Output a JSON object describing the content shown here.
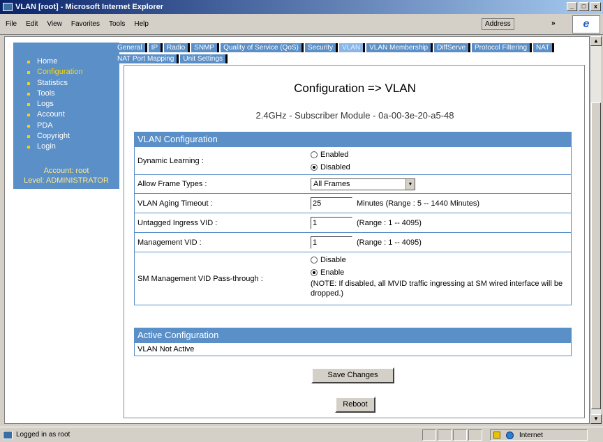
{
  "window": {
    "title": "VLAN [root] - Microsoft Internet Explorer",
    "buttons": [
      "_",
      "□",
      "x"
    ]
  },
  "menubar": {
    "items": [
      "File",
      "Edit",
      "View",
      "Favorites",
      "Tools",
      "Help"
    ],
    "address_label": "Address",
    "go_label": "»"
  },
  "leftnav": {
    "items": [
      "Home",
      "Configuration",
      "Statistics",
      "Tools",
      "Logs",
      "Account",
      "PDA",
      "Copyright",
      "Login"
    ],
    "account_line": "Account: root",
    "level_line": "Level: ADMINISTRATOR"
  },
  "tabs": [
    "General",
    "IP",
    "Radio",
    "SNMP",
    "Quality of Service (QoS)",
    "Security",
    "VLAN",
    "VLAN Membership",
    "DiffServe",
    "Protocol Filtering",
    "NAT",
    "NAT Port Mapping",
    "Unit Settings"
  ],
  "page": {
    "title": "Configuration => VLAN",
    "subtitle": "2.4GHz - Subscriber Module - 0a-00-3e-20-a5-48"
  },
  "vlan_config": {
    "header": "VLAN Configuration",
    "dynamic_learning": {
      "label": "Dynamic Learning :",
      "opt_enabled": "Enabled",
      "opt_disabled": "Disabled",
      "selected": "Disabled"
    },
    "frame_types": {
      "label": "Allow Frame Types :",
      "value": "All Frames"
    },
    "aging_timeout": {
      "label": "VLAN Aging Timeout :",
      "value": "25",
      "hint": "Minutes (Range : 5 -- 1440 Minutes)"
    },
    "untagged_vid": {
      "label": "Untagged Ingress VID :",
      "value": "1",
      "hint": "(Range : 1 -- 4095)"
    },
    "mgmt_vid": {
      "label": "Management VID :",
      "value": "1",
      "hint": "(Range : 1 -- 4095)"
    },
    "passthrough": {
      "label": "SM Management VID Pass-through :",
      "opt_disable": "Disable",
      "opt_enable": "Enable",
      "selected": "Enable",
      "note": "(NOTE: If disabled, all MVID traffic ingressing at SM wired interface will be dropped.)"
    }
  },
  "active_config": {
    "header": "Active Configuration",
    "status": "VLAN Not Active"
  },
  "buttons": {
    "save": "Save Changes",
    "reboot": "Reboot"
  },
  "statusbar": {
    "text": "Logged in as root",
    "zone": "Internet"
  }
}
